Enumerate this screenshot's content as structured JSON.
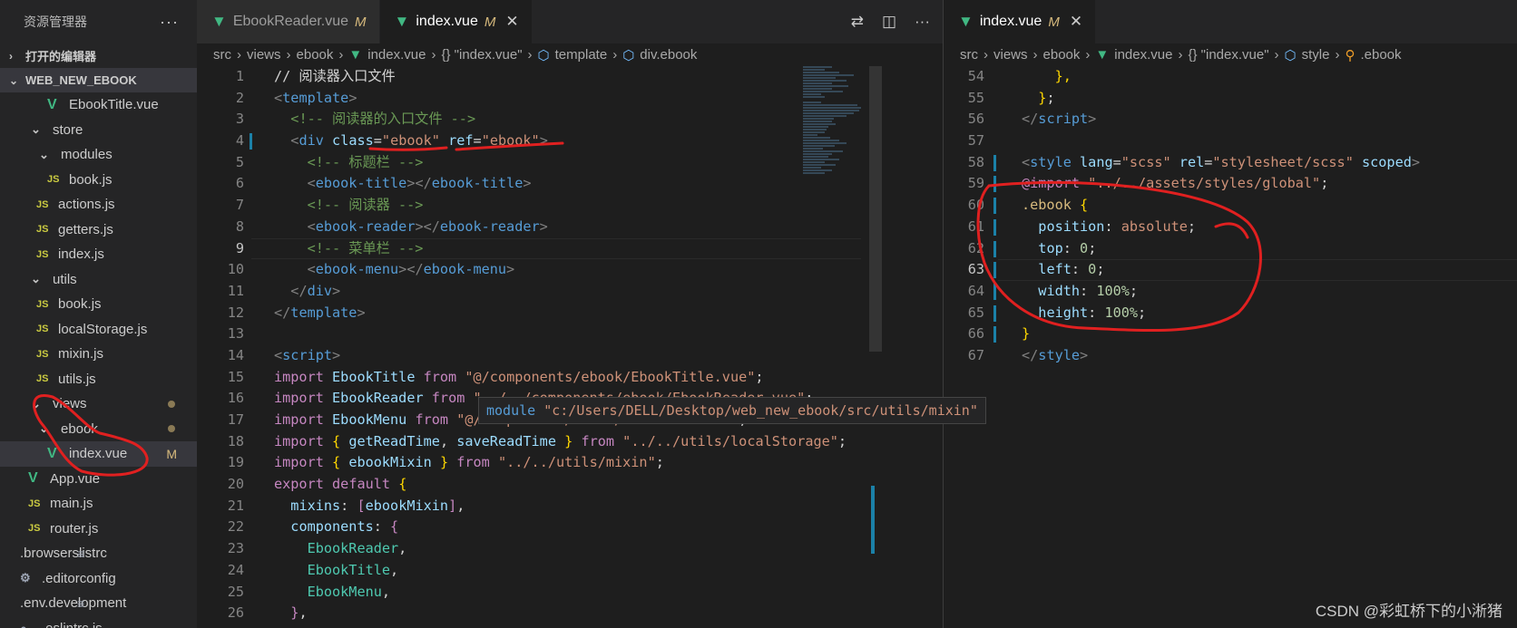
{
  "sidebar": {
    "title": "资源管理器",
    "more": "···",
    "open_editors": "打开的编辑器",
    "root": "WEB_NEW_EBOOK",
    "items": [
      {
        "label": "EbookTitle.vue",
        "icon": "V",
        "kind": "vue",
        "indent": 52
      },
      {
        "label": "store",
        "icon": "⌄",
        "kind": "fold",
        "indent": 34
      },
      {
        "label": "modules",
        "icon": "⌄",
        "kind": "fold",
        "indent": 43
      },
      {
        "label": "book.js",
        "icon": "JS",
        "kind": "js",
        "indent": 52
      },
      {
        "label": "actions.js",
        "icon": "JS",
        "kind": "js",
        "indent": 40
      },
      {
        "label": "getters.js",
        "icon": "JS",
        "kind": "js",
        "indent": 40
      },
      {
        "label": "index.js",
        "icon": "JS",
        "kind": "js",
        "indent": 40
      },
      {
        "label": "utils",
        "icon": "⌄",
        "kind": "fold",
        "indent": 34
      },
      {
        "label": "book.js",
        "icon": "JS",
        "kind": "js",
        "indent": 40
      },
      {
        "label": "localStorage.js",
        "icon": "JS",
        "kind": "js",
        "indent": 40
      },
      {
        "label": "mixin.js",
        "icon": "JS",
        "kind": "js",
        "indent": 40
      },
      {
        "label": "utils.js",
        "icon": "JS",
        "kind": "js",
        "indent": 40
      },
      {
        "label": "views",
        "icon": "⌄",
        "kind": "fold",
        "indent": 34,
        "dot": true
      },
      {
        "label": "ebook",
        "icon": "⌄",
        "kind": "fold",
        "indent": 43,
        "dot": true
      },
      {
        "label": "index.vue",
        "icon": "V",
        "kind": "vue",
        "indent": 52,
        "badge": "M",
        "active": true
      },
      {
        "label": "App.vue",
        "icon": "V",
        "kind": "vue",
        "indent": 31
      },
      {
        "label": "main.js",
        "icon": "JS",
        "kind": "js",
        "indent": 31
      },
      {
        "label": "router.js",
        "icon": "JS",
        "kind": "js",
        "indent": 31
      },
      {
        "label": ".browserslistrc",
        "icon": "≡",
        "kind": "txt",
        "indent": 22
      },
      {
        "label": ".editorconfig",
        "icon": "⚙",
        "kind": "cfg",
        "indent": 22
      },
      {
        "label": ".env.development",
        "icon": "≡",
        "kind": "txt",
        "indent": 22
      },
      {
        "label": ".eslintrc.js",
        "icon": "●",
        "kind": "cfg",
        "indent": 22
      }
    ]
  },
  "left_editor": {
    "tabs": [
      {
        "label": "EbookReader.vue",
        "modified": "M",
        "active": false
      },
      {
        "label": "index.vue",
        "modified": "M",
        "active": true,
        "close": "✕"
      }
    ],
    "breadcrumb": [
      "src",
      "views",
      "ebook",
      "index.vue",
      "{} \"index.vue\"",
      "template",
      "div.ebook"
    ],
    "tooltip": {
      "keyword": "module",
      "path": "\"c:/Users/DELL/Desktop/web_new_ebook/src/utils/mixin\""
    },
    "lines": [
      {
        "n": "1",
        "tokens": [
          [
            "c-def",
            "// 阅读器入口文件"
          ]
        ]
      },
      {
        "n": "2",
        "tokens": [
          [
            "c-br",
            "<"
          ],
          [
            "c-tag",
            "template"
          ],
          [
            "c-br",
            ">"
          ]
        ]
      },
      {
        "n": "3",
        "tokens": [
          [
            "c-def",
            "  "
          ],
          [
            "c-cmt",
            "<!-- 阅读器的入口文件 -->"
          ]
        ]
      },
      {
        "n": "4",
        "tokens": [
          [
            "c-def",
            "  "
          ],
          [
            "c-br",
            "<"
          ],
          [
            "c-tag",
            "div"
          ],
          [
            "c-def",
            " "
          ],
          [
            "c-attr",
            "class"
          ],
          [
            "c-def",
            "="
          ],
          [
            "c-str",
            "\"ebook\""
          ],
          [
            "c-def",
            " "
          ],
          [
            "c-attr",
            "ref"
          ],
          [
            "c-def",
            "="
          ],
          [
            "c-str",
            "\"ebook\""
          ],
          [
            "c-br",
            ">"
          ]
        ],
        "git": true
      },
      {
        "n": "5",
        "tokens": [
          [
            "c-def",
            "    "
          ],
          [
            "c-cmt",
            "<!-- 标题栏 -->"
          ]
        ]
      },
      {
        "n": "6",
        "tokens": [
          [
            "c-def",
            "    "
          ],
          [
            "c-br",
            "<"
          ],
          [
            "c-tag",
            "ebook-title"
          ],
          [
            "c-br",
            "></"
          ],
          [
            "c-tag",
            "ebook-title"
          ],
          [
            "c-br",
            ">"
          ]
        ]
      },
      {
        "n": "7",
        "tokens": [
          [
            "c-def",
            "    "
          ],
          [
            "c-cmt",
            "<!-- 阅读器 -->"
          ]
        ]
      },
      {
        "n": "8",
        "tokens": [
          [
            "c-def",
            "    "
          ],
          [
            "c-br",
            "<"
          ],
          [
            "c-tag",
            "ebook-reader"
          ],
          [
            "c-br",
            "></"
          ],
          [
            "c-tag",
            "ebook-reader"
          ],
          [
            "c-br",
            ">"
          ]
        ]
      },
      {
        "n": "9",
        "tokens": [
          [
            "c-def",
            "    "
          ],
          [
            "c-cmt",
            "<!-- 菜单栏 -->"
          ]
        ],
        "current": true
      },
      {
        "n": "10",
        "tokens": [
          [
            "c-def",
            "    "
          ],
          [
            "c-br",
            "<"
          ],
          [
            "c-tag",
            "ebook-menu"
          ],
          [
            "c-br",
            "></"
          ],
          [
            "c-tag",
            "ebook-menu"
          ],
          [
            "c-br",
            ">"
          ]
        ]
      },
      {
        "n": "11",
        "tokens": [
          [
            "c-def",
            "  "
          ],
          [
            "c-br",
            "</"
          ],
          [
            "c-tag",
            "div"
          ],
          [
            "c-br",
            ">"
          ]
        ]
      },
      {
        "n": "12",
        "tokens": [
          [
            "c-br",
            "</"
          ],
          [
            "c-tag",
            "template"
          ],
          [
            "c-br",
            ">"
          ]
        ]
      },
      {
        "n": "13",
        "tokens": []
      },
      {
        "n": "14",
        "tokens": [
          [
            "c-br",
            "<"
          ],
          [
            "c-tag",
            "script"
          ],
          [
            "c-br",
            ">"
          ]
        ]
      },
      {
        "n": "15",
        "tokens": [
          [
            "c-kw",
            "import"
          ],
          [
            "c-def",
            " "
          ],
          [
            "c-var",
            "EbookTitle"
          ],
          [
            "c-def",
            " "
          ],
          [
            "c-kw",
            "from"
          ],
          [
            "c-def",
            " "
          ],
          [
            "c-str",
            "\"@/components/ebook/EbookTitle.vue\""
          ],
          [
            "c-def",
            ";"
          ]
        ]
      },
      {
        "n": "16",
        "tokens": [
          [
            "c-kw",
            "import"
          ],
          [
            "c-def",
            " "
          ],
          [
            "c-var",
            "EbookReader"
          ],
          [
            "c-def",
            " "
          ],
          [
            "c-kw",
            "from"
          ],
          [
            "c-def",
            " "
          ],
          [
            "c-str",
            "\"../../components/ebook/EbookReader.vue\""
          ],
          [
            "c-def",
            ";"
          ]
        ]
      },
      {
        "n": "17",
        "tokens": [
          [
            "c-kw",
            "import"
          ],
          [
            "c-def",
            " "
          ],
          [
            "c-var",
            "EbookMenu"
          ],
          [
            "c-def",
            " "
          ],
          [
            "c-kw",
            "from"
          ],
          [
            "c-def",
            " "
          ],
          [
            "c-str",
            "\"@/components/ebook/EbookMenu.vue\""
          ],
          [
            "c-def",
            ";"
          ]
        ]
      },
      {
        "n": "18",
        "tokens": [
          [
            "c-kw",
            "import"
          ],
          [
            "c-def",
            " "
          ],
          [
            "c-y",
            "{"
          ],
          [
            "c-def",
            " "
          ],
          [
            "c-var",
            "getReadTime"
          ],
          [
            "c-def",
            ", "
          ],
          [
            "c-var",
            "saveReadTime"
          ],
          [
            "c-def",
            " "
          ],
          [
            "c-y",
            "}"
          ],
          [
            "c-def",
            " "
          ],
          [
            "c-kw",
            "from"
          ],
          [
            "c-def",
            " "
          ],
          [
            "c-str",
            "\"../../utils/localStorage\""
          ],
          [
            "c-def",
            ";"
          ]
        ]
      },
      {
        "n": "19",
        "tokens": [
          [
            "c-kw",
            "import"
          ],
          [
            "c-def",
            " "
          ],
          [
            "c-y",
            "{"
          ],
          [
            "c-def",
            " "
          ],
          [
            "c-var",
            "ebookMixin"
          ],
          [
            "c-def",
            " "
          ],
          [
            "c-y",
            "}"
          ],
          [
            "c-def",
            " "
          ],
          [
            "c-kw",
            "from"
          ],
          [
            "c-def",
            " "
          ],
          [
            "c-str",
            "\"../../utils/mixin\""
          ],
          [
            "c-def",
            ";"
          ]
        ]
      },
      {
        "n": "20",
        "tokens": [
          [
            "c-kw",
            "export"
          ],
          [
            "c-def",
            " "
          ],
          [
            "c-kw",
            "default"
          ],
          [
            "c-def",
            " "
          ],
          [
            "c-y",
            "{"
          ]
        ]
      },
      {
        "n": "21",
        "tokens": [
          [
            "c-def",
            "  "
          ],
          [
            "c-var",
            "mixins"
          ],
          [
            "c-def",
            ": "
          ],
          [
            "c-kw",
            "["
          ],
          [
            "c-var",
            "ebookMixin"
          ],
          [
            "c-kw",
            "]"
          ],
          [
            "c-def",
            ","
          ]
        ]
      },
      {
        "n": "22",
        "tokens": [
          [
            "c-def",
            "  "
          ],
          [
            "c-var",
            "components"
          ],
          [
            "c-def",
            ": "
          ],
          [
            "c-kw",
            "{"
          ]
        ]
      },
      {
        "n": "23",
        "tokens": [
          [
            "c-def",
            "    "
          ],
          [
            "c-cls",
            "EbookReader"
          ],
          [
            "c-def",
            ","
          ]
        ]
      },
      {
        "n": "24",
        "tokens": [
          [
            "c-def",
            "    "
          ],
          [
            "c-cls",
            "EbookTitle"
          ],
          [
            "c-def",
            ","
          ]
        ]
      },
      {
        "n": "25",
        "tokens": [
          [
            "c-def",
            "    "
          ],
          [
            "c-cls",
            "EbookMenu"
          ],
          [
            "c-def",
            ","
          ]
        ]
      },
      {
        "n": "26",
        "tokens": [
          [
            "c-def",
            "  "
          ],
          [
            "c-kw",
            "}"
          ],
          [
            "c-def",
            ","
          ]
        ]
      }
    ]
  },
  "right_editor": {
    "tabs": [
      {
        "label": "index.vue",
        "modified": "M",
        "active": true,
        "close": "✕"
      }
    ],
    "breadcrumb": [
      "src",
      "views",
      "ebook",
      "index.vue",
      "{} \"index.vue\"",
      "style",
      ".ebook"
    ],
    "lines": [
      {
        "n": "54",
        "tokens": [
          [
            "c-def",
            "    "
          ],
          [
            "c-y",
            "},"
          ]
        ]
      },
      {
        "n": "55",
        "tokens": [
          [
            "c-def",
            "  "
          ],
          [
            "c-y",
            "}"
          ],
          [
            "c-def",
            ";"
          ]
        ]
      },
      {
        "n": "56",
        "tokens": [
          [
            "c-br",
            "</"
          ],
          [
            "c-tag",
            "script"
          ],
          [
            "c-br",
            ">"
          ]
        ]
      },
      {
        "n": "57",
        "tokens": []
      },
      {
        "n": "58",
        "tokens": [
          [
            "c-br",
            "<"
          ],
          [
            "c-tag",
            "style"
          ],
          [
            "c-def",
            " "
          ],
          [
            "c-attr",
            "lang"
          ],
          [
            "c-def",
            "="
          ],
          [
            "c-str",
            "\"scss\""
          ],
          [
            "c-def",
            " "
          ],
          [
            "c-attr",
            "rel"
          ],
          [
            "c-def",
            "="
          ],
          [
            "c-str",
            "\"stylesheet/scss\""
          ],
          [
            "c-def",
            " "
          ],
          [
            "c-attr",
            "scoped"
          ],
          [
            "c-br",
            ">"
          ]
        ],
        "git": true
      },
      {
        "n": "59",
        "tokens": [
          [
            "c-kw",
            "@import"
          ],
          [
            "c-def",
            " "
          ],
          [
            "c-str",
            "\"../../assets/styles/global\""
          ],
          [
            "c-def",
            ";"
          ]
        ],
        "git": true
      },
      {
        "n": "60",
        "tokens": [
          [
            "c-sel",
            ".ebook"
          ],
          [
            "c-def",
            " "
          ],
          [
            "c-y",
            "{"
          ]
        ],
        "git": true
      },
      {
        "n": "61",
        "tokens": [
          [
            "c-def",
            "  "
          ],
          [
            "c-var",
            "position"
          ],
          [
            "c-def",
            ": "
          ],
          [
            "c-str",
            "absolute"
          ],
          [
            "c-def",
            ";"
          ]
        ],
        "git": true
      },
      {
        "n": "62",
        "tokens": [
          [
            "c-def",
            "  "
          ],
          [
            "c-var",
            "top"
          ],
          [
            "c-def",
            ": "
          ],
          [
            "c-num",
            "0"
          ],
          [
            "c-def",
            ";"
          ]
        ],
        "git": true
      },
      {
        "n": "63",
        "tokens": [
          [
            "c-def",
            "  "
          ],
          [
            "c-var",
            "left"
          ],
          [
            "c-def",
            ": "
          ],
          [
            "c-num",
            "0"
          ],
          [
            "c-def",
            ";"
          ]
        ],
        "git": true,
        "current": true
      },
      {
        "n": "64",
        "tokens": [
          [
            "c-def",
            "  "
          ],
          [
            "c-var",
            "width"
          ],
          [
            "c-def",
            ": "
          ],
          [
            "c-num",
            "100%"
          ],
          [
            "c-def",
            ";"
          ]
        ],
        "git": true
      },
      {
        "n": "65",
        "tokens": [
          [
            "c-def",
            "  "
          ],
          [
            "c-var",
            "height"
          ],
          [
            "c-def",
            ": "
          ],
          [
            "c-num",
            "100%"
          ],
          [
            "c-def",
            ";"
          ]
        ],
        "git": true
      },
      {
        "n": "66",
        "tokens": [
          [
            "c-y",
            "}"
          ]
        ],
        "git": true
      },
      {
        "n": "67",
        "tokens": [
          [
            "c-br",
            "</"
          ],
          [
            "c-tag",
            "style"
          ],
          [
            "c-br",
            ">"
          ]
        ]
      }
    ]
  },
  "watermark": "CSDN @彩虹桥下的小淅猪",
  "colors": {
    "annotation": "#e02020",
    "vue": "#41b883",
    "js": "#cbcb41",
    "modified": "#d7ba7d"
  }
}
